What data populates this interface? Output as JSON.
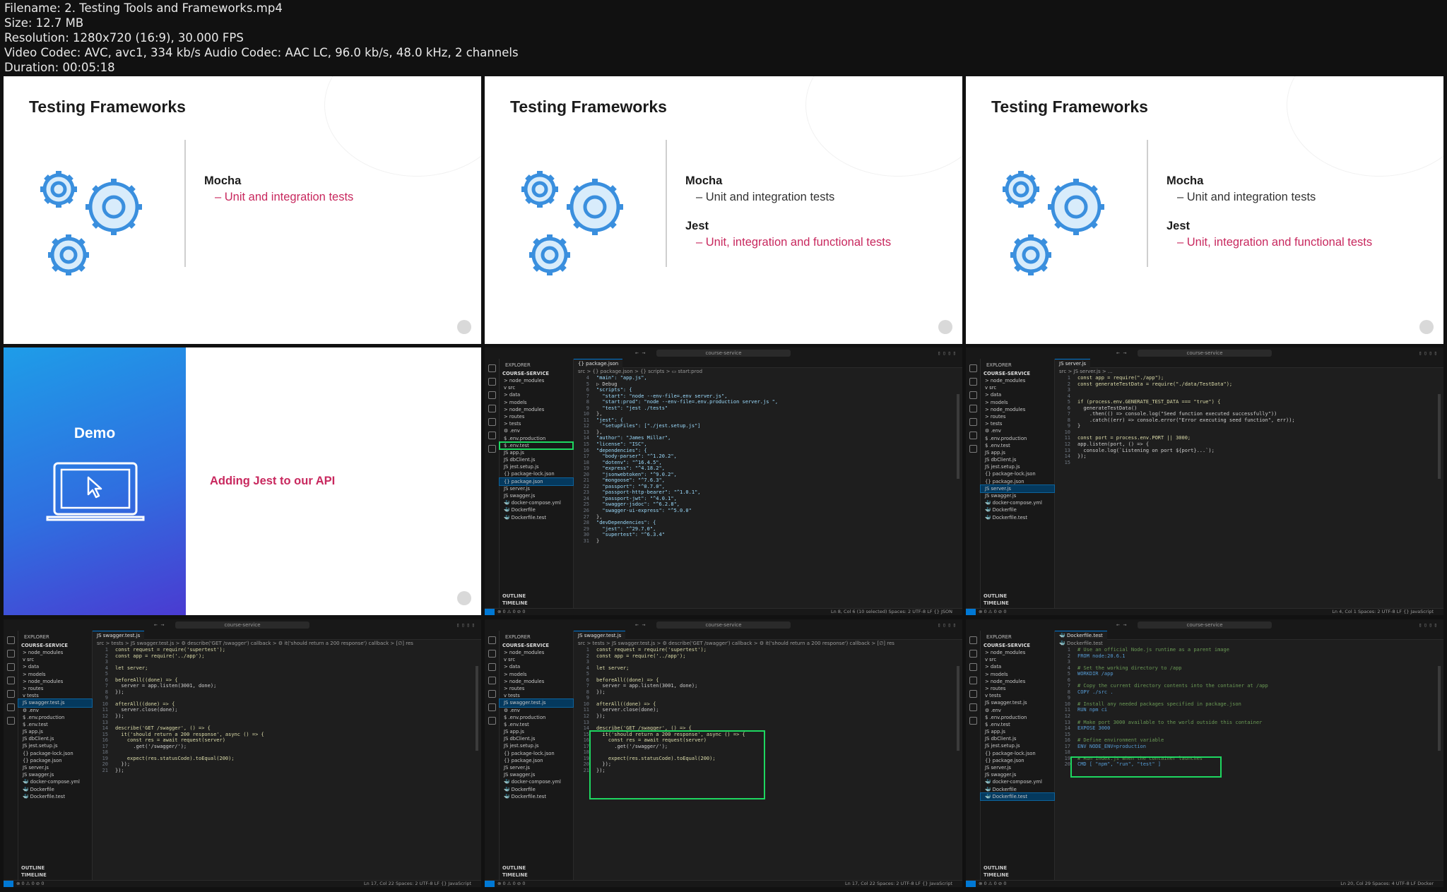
{
  "file_info": {
    "filename": "Filename: 2. Testing Tools and Frameworks.mp4",
    "size": "Size: 12.7 MB",
    "resolution": "Resolution: 1280x720 (16:9), 30.000 FPS",
    "codec": "Video Codec: AVC, avc1, 334 kb/s Audio Codec: AAC LC, 96.0 kb/s, 48.0 kHz, 2 channels",
    "duration": "Duration: 00:05:18"
  },
  "slides": [
    {
      "title": "Testing Frameworks",
      "mocha": "Mocha",
      "mocha_sub": "– Unit and integration tests"
    },
    {
      "title": "Testing Frameworks",
      "mocha": "Mocha",
      "mocha_sub": "– Unit and integration tests",
      "jest": "Jest",
      "jest_sub": "– Unit, integration and functional tests"
    },
    {
      "title": "Testing Frameworks",
      "mocha": "Mocha",
      "mocha_sub": "– Unit and integration tests",
      "jest": "Jest",
      "jest_sub": "– Unit, integration and functional tests"
    }
  ],
  "demo": {
    "label": "Demo",
    "subtitle": "Adding Jest to our API"
  },
  "vscode": {
    "search": "course-service",
    "explorer": "EXPLORER",
    "root": "COURSE-SERVICE",
    "outline": "OUTLINE",
    "timeline": "TIMELINE",
    "tree_a": [
      "> node_modules",
      "v src",
      "  > data",
      "  > models",
      "  > node_modules",
      "  > routes",
      "  > tests",
      "  ⚙ .env",
      "  $ .env.production",
      "  $ .env.test",
      "  JS app.js",
      "  JS dbClient.js",
      "  JS jest.setup.js",
      "  {} package-lock.json",
      "  {} package.json",
      "  JS server.js",
      "  JS swagger.js",
      "  🐳 docker-compose.yml",
      "  🐳 Dockerfile",
      "  🐳 Dockerfile.test"
    ],
    "tree_b": [
      "> node_modules",
      "v src",
      "  > data",
      "  > models",
      "  > node_modules",
      "  > routes",
      "  v tests",
      "    JS swagger.test.js",
      "  ⚙ .env",
      "  $ .env.production",
      "  $ .env.test",
      "  JS app.js",
      "  JS dbClient.js",
      "  JS jest.setup.js",
      "  {} package-lock.json",
      "  {} package.json",
      "  JS server.js",
      "  JS swagger.js",
      "  🐳 docker-compose.yml",
      "  🐳 Dockerfile",
      "  🐳 Dockerfile.test"
    ],
    "package_tab": "{} package.json",
    "package_crumb": "src > {} package.json > {} scripts > ▭ start:prod",
    "package_code": [
      [
        "4",
        "\"main\": \"app.js\","
      ],
      [
        "5",
        "▷ Debug"
      ],
      [
        "6",
        "\"scripts\": {"
      ],
      [
        "7",
        "  \"start\": \"node --env-file=.env server.js\","
      ],
      [
        "8",
        "  \"start:prod\": \"node --env-file=.env.production server.js \","
      ],
      [
        "9",
        "  \"test\": \"jest ./tests\""
      ],
      [
        "10",
        "},"
      ],
      [
        "11",
        "\"jest\": {"
      ],
      [
        "12",
        "  \"setupFiles\": [\"./jest.setup.js\"]"
      ],
      [
        "13",
        "},"
      ],
      [
        "14",
        "\"author\": \"James Millar\","
      ],
      [
        "15",
        "\"license\": \"ISC\","
      ],
      [
        "16",
        "\"dependencies\": {"
      ],
      [
        "17",
        "  \"body-parser\": \"^1.20.2\","
      ],
      [
        "18",
        "  \"dotenv\": \"^16.4.5\","
      ],
      [
        "19",
        "  \"express\": \"^4.18.2\","
      ],
      [
        "20",
        "  \"jsonwebtoken\": \"^9.0.2\","
      ],
      [
        "21",
        "  \"mongoose\": \"^7.6.3\","
      ],
      [
        "22",
        "  \"passport\": \"^0.7.0\","
      ],
      [
        "23",
        "  \"passport-http-bearer\": \"^1.0.1\","
      ],
      [
        "24",
        "  \"passport-jwt\": \"^4.0.1\","
      ],
      [
        "25",
        "  \"swagger-jsdoc\": \"^6.2.8\","
      ],
      [
        "26",
        "  \"swagger-ui-express\": \"^5.0.0\""
      ],
      [
        "27",
        "},"
      ],
      [
        "28",
        "\"devDependencies\": {"
      ],
      [
        "29",
        "  \"jest\": \"^29.7.0\","
      ],
      [
        "30",
        "  \"supertest\": \"^6.3.4\""
      ],
      [
        "31",
        "}"
      ]
    ],
    "package_status": "Ln 8, Col 6 (10 selected)   Spaces: 2   UTF-8   LF   {} JSON",
    "server_tab": "JS server.js",
    "server_crumb": "src > JS server.js > ...",
    "server_code": [
      [
        "1",
        "const app = require(\"./app\");"
      ],
      [
        "2",
        "const generateTestData = require(\"./data/TestData\");"
      ],
      [
        "3",
        ""
      ],
      [
        "4",
        ""
      ],
      [
        "5",
        "if (process.env.GENERATE_TEST_DATA === \"true\") {"
      ],
      [
        "6",
        "  generateTestData()"
      ],
      [
        "7",
        "    .then(() => console.log(\"Seed function executed successfully\"))"
      ],
      [
        "8",
        "    .catch((err) => console.error(\"Error executing seed function\", err));"
      ],
      [
        "9",
        "}"
      ],
      [
        "10",
        ""
      ],
      [
        "11",
        "const port = process.env.PORT || 3000;"
      ],
      [
        "12",
        "app.listen(port, () => {"
      ],
      [
        "13",
        "  console.log(`Listening on port ${port}...`);"
      ],
      [
        "14",
        "});"
      ],
      [
        "15",
        ""
      ]
    ],
    "server_status": "Ln 4, Col 1   Spaces: 2   UTF-8   LF   {} JavaScript",
    "test_tab": "JS swagger.test.js",
    "test_crumb": "src > tests > JS swagger.test.js > ⚙ describe('GET /swagger') callback > ⚙ it('should return a 200 response') callback > [∅] res",
    "test_code": [
      [
        "1",
        "const request = require('supertest');"
      ],
      [
        "2",
        "const app = require('../app');"
      ],
      [
        "3",
        ""
      ],
      [
        "4",
        "let server;"
      ],
      [
        "5",
        ""
      ],
      [
        "6",
        "beforeAll((done) => {"
      ],
      [
        "7",
        "  server = app.listen(3001, done);"
      ],
      [
        "8",
        "});"
      ],
      [
        "9",
        ""
      ],
      [
        "10",
        "afterAll((done) => {"
      ],
      [
        "11",
        "  server.close(done);"
      ],
      [
        "12",
        "});"
      ],
      [
        "13",
        ""
      ],
      [
        "14",
        "describe('GET /swagger', () => {"
      ],
      [
        "15",
        "  it('should return a 200 response', async () => {"
      ],
      [
        "16",
        "    const res = await request(server)"
      ],
      [
        "17",
        "      .get('/swagger/');"
      ],
      [
        "18",
        ""
      ],
      [
        "19",
        "    expect(res.statusCode).toEqual(200);"
      ],
      [
        "20",
        "  });"
      ],
      [
        "21",
        "});"
      ]
    ],
    "test_status": "Ln 17, Col 22   Spaces: 2   UTF-8   LF   {} JavaScript",
    "docker_tab": "🐳 Dockerfile.test",
    "docker_crumb": "🐳 Dockerfile.test",
    "docker_code": [
      [
        "1",
        "# Use an official Node.js runtime as a parent image"
      ],
      [
        "2",
        "FROM node:20.6.1"
      ],
      [
        "3",
        ""
      ],
      [
        "4",
        "# Set the working directory to /app"
      ],
      [
        "5",
        "WORKDIR /app"
      ],
      [
        "6",
        ""
      ],
      [
        "7",
        "# Copy the current directory contents into the container at /app"
      ],
      [
        "8",
        "COPY ./src ."
      ],
      [
        "9",
        ""
      ],
      [
        "10",
        "# Install any needed packages specified in package.json"
      ],
      [
        "11",
        "RUN npm ci"
      ],
      [
        "12",
        ""
      ],
      [
        "13",
        "# Make port 3000 available to the world outside this container"
      ],
      [
        "14",
        "EXPOSE 3000"
      ],
      [
        "15",
        ""
      ],
      [
        "16",
        "# Define environment variable"
      ],
      [
        "17",
        "ENV NODE_ENV=production"
      ],
      [
        "18",
        ""
      ],
      [
        "19",
        "# Run index.js when the container launches"
      ],
      [
        "20",
        "CMD [ \"npm\", \"run\", \"test\" ]"
      ]
    ],
    "docker_status": "Ln 20, Col 29   Spaces: 4   UTF-8   LF   Docker",
    "status_left": "⊗ 0 ⚠ 0   ⊘ 0"
  },
  "colors": {
    "accent": "#c8285e",
    "highlight_box": "#1ed760",
    "vscode_bg": "#1e1e1e"
  }
}
